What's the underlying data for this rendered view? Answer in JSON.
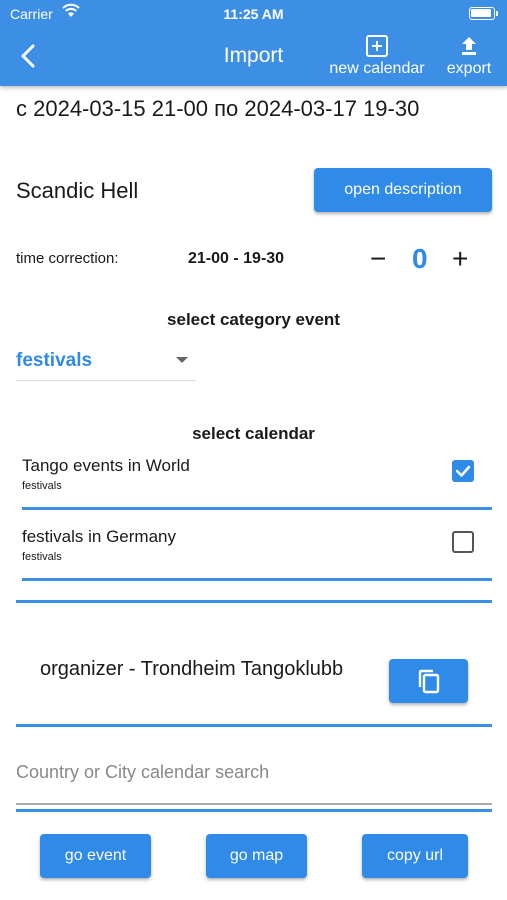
{
  "status": {
    "carrier": "Carrier",
    "time": "11:25 AM"
  },
  "appbar": {
    "title": "Import",
    "new_calendar": "new calendar",
    "export": "export"
  },
  "event": {
    "date_range": "с 2024-03-15 21-00 по 2024-03-17 19-30",
    "name": "Scandic Hell",
    "open_description": "open description"
  },
  "time_correction": {
    "label": "time correction:",
    "value": "21-00 - 19-30",
    "minus": "−",
    "count": "0",
    "plus": "+"
  },
  "category": {
    "heading": "select category event",
    "selected": "festivals"
  },
  "calendars": {
    "heading": "select calendar",
    "items": [
      {
        "name": "Tango events in World",
        "sub": "festivals",
        "checked": true
      },
      {
        "name": "festivals in Germany",
        "sub": "festivals",
        "checked": false
      }
    ]
  },
  "organizer": {
    "text": "organizer - Trondheim Tangoklubb"
  },
  "search": {
    "placeholder": "Country or City calendar search"
  },
  "buttons": {
    "go_event": "go event",
    "go_map": "go map",
    "copy_url": "copy url"
  },
  "colors": {
    "accent": "#3d8fe6",
    "button": "#2f8ae8"
  }
}
